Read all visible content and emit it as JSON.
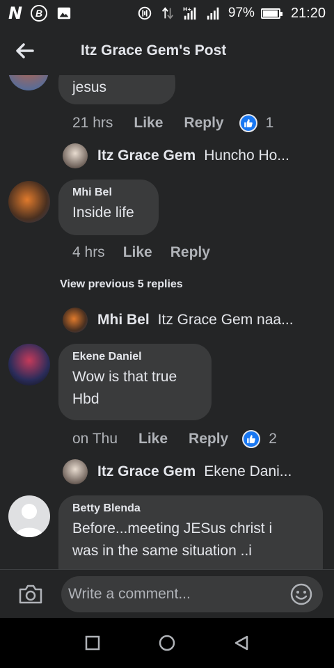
{
  "status_bar": {
    "battery_percent": "97%",
    "battery_level": 0.97,
    "time": "21:20",
    "icons": [
      "n-logo-icon",
      "b-circle-icon",
      "gallery-icon",
      "alarm-icon",
      "data-arrows-icon",
      "signal-hplus-icon",
      "signal-icon",
      "battery-icon"
    ]
  },
  "header": {
    "title": "Itz Grace Gem's Post",
    "back_icon": "back-arrow-icon"
  },
  "comments": {
    "c0": {
      "text": "jesus",
      "time": "21 hrs",
      "like": "Like",
      "reply": "Reply",
      "reaction_count": "1"
    },
    "r0": {
      "name": "Itz Grace Gem",
      "snippet": "Huncho Ho..."
    },
    "c1": {
      "author": "Mhi Bel",
      "text": "Inside life",
      "time": "4 hrs",
      "like": "Like",
      "reply": "Reply"
    },
    "view_previous": "View previous 5 replies",
    "r1": {
      "name": "Mhi Bel",
      "snippet": "Itz Grace Gem naa..."
    },
    "c2": {
      "author": "Ekene Daniel",
      "line1": "Wow is that true",
      "line2": "Hbd",
      "time": "on Thu",
      "like": "Like",
      "reply": "Reply",
      "reaction_count": "2"
    },
    "r2": {
      "name": "Itz Grace Gem",
      "snippet": "Ekene Dani..."
    },
    "c3": {
      "author": "Betty Blenda",
      "line1": "Before...meeting JESus christ i",
      "line2": "was in the same situation ..i"
    }
  },
  "composer": {
    "placeholder": "Write a comment...",
    "camera_icon": "camera-icon",
    "emoji_icon": "emoji-icon"
  },
  "nav_bar": {
    "icons": [
      "recent-apps-icon",
      "home-icon",
      "back-icon"
    ]
  },
  "colors": {
    "background": "#242526",
    "bubble": "#3a3b3c",
    "text_primary": "#e4e6eb",
    "text_secondary": "#b0b3b8",
    "like_blue": "#1877f2"
  }
}
